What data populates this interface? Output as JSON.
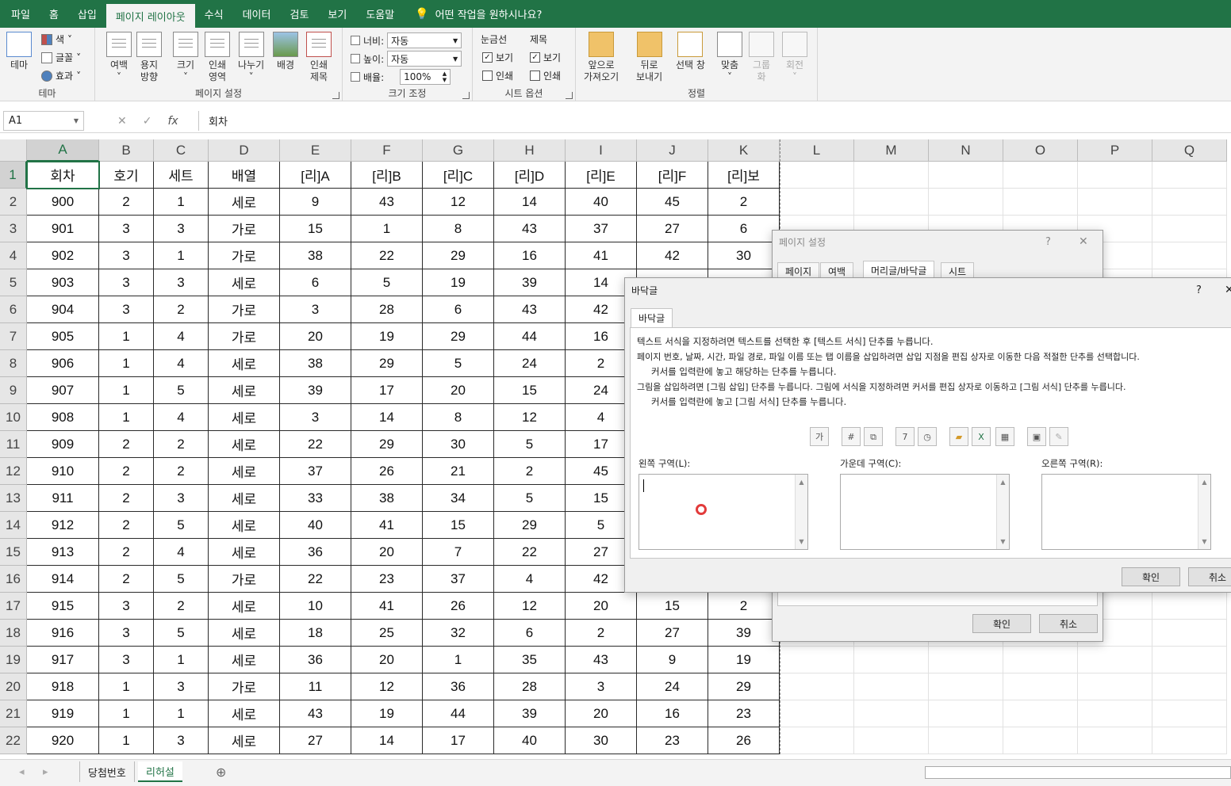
{
  "menu": {
    "tabs": [
      "파일",
      "홈",
      "삽입",
      "페이지 레이아웃",
      "수식",
      "데이터",
      "검토",
      "보기",
      "도움말"
    ],
    "active_tab": "페이지 레이아웃",
    "tell_me": "어떤 작업을 원하시나요?"
  },
  "ribbon": {
    "theme": {
      "label": "테마",
      "btn": "테마",
      "colors": "색",
      "fonts": "글꼴",
      "effects": "효과"
    },
    "page_setup": {
      "label": "페이지 설정",
      "margins": "여백",
      "orientation_1": "용지",
      "orientation_2": "방향",
      "size": "크기",
      "print_area_1": "인쇄",
      "print_area_2": "영역",
      "breaks": "나누기",
      "background": "배경",
      "print_titles_1": "인쇄",
      "print_titles_2": "제목"
    },
    "scale": {
      "label": "크기 조정",
      "width_label": "너비:",
      "width_value": "자동",
      "height_label": "높이:",
      "height_value": "자동",
      "scale_label": "배율:",
      "scale_value": "100%"
    },
    "sheet_options": {
      "label": "시트 옵션",
      "gridlines": "눈금선",
      "headings": "제목",
      "view": "보기",
      "print": "인쇄"
    },
    "arrange": {
      "label": "정렬",
      "bring_forward_1": "앞으로",
      "bring_forward_2": "가져오기",
      "send_backward_1": "뒤로",
      "send_backward_2": "보내기",
      "selection_pane": "선택 창",
      "align": "맞춤",
      "group_1": "그룹",
      "group_2": "화",
      "rotate": "회전"
    }
  },
  "formula_bar": {
    "name_box": "A1",
    "content": "회차",
    "fx": "fx"
  },
  "grid": {
    "columns": [
      "A",
      "B",
      "C",
      "D",
      "E",
      "F",
      "G",
      "H",
      "I",
      "J",
      "K",
      "L",
      "M",
      "N",
      "O",
      "P",
      "Q"
    ],
    "header_row": [
      "회차",
      "호기",
      "세트",
      "배열",
      "[리]A",
      "[리]B",
      "[리]C",
      "[리]D",
      "[리]E",
      "[리]F",
      "[리]보"
    ],
    "rows": [
      [
        "900",
        "2",
        "1",
        "세로",
        "9",
        "43",
        "12",
        "14",
        "40",
        "45",
        "2"
      ],
      [
        "901",
        "3",
        "3",
        "가로",
        "15",
        "1",
        "8",
        "43",
        "37",
        "27",
        "6"
      ],
      [
        "902",
        "3",
        "1",
        "가로",
        "38",
        "22",
        "29",
        "16",
        "41",
        "42",
        "30"
      ],
      [
        "903",
        "3",
        "3",
        "세로",
        "6",
        "5",
        "19",
        "39",
        "14",
        "",
        ""
      ],
      [
        "904",
        "3",
        "2",
        "가로",
        "3",
        "28",
        "6",
        "43",
        "42",
        "",
        ""
      ],
      [
        "905",
        "1",
        "4",
        "가로",
        "20",
        "19",
        "29",
        "44",
        "16",
        "",
        ""
      ],
      [
        "906",
        "1",
        "4",
        "세로",
        "38",
        "29",
        "5",
        "24",
        "2",
        "",
        ""
      ],
      [
        "907",
        "1",
        "5",
        "세로",
        "39",
        "17",
        "20",
        "15",
        "24",
        "",
        ""
      ],
      [
        "908",
        "1",
        "4",
        "세로",
        "3",
        "14",
        "8",
        "12",
        "4",
        "",
        ""
      ],
      [
        "909",
        "2",
        "2",
        "세로",
        "22",
        "29",
        "30",
        "5",
        "17",
        "",
        ""
      ],
      [
        "910",
        "2",
        "2",
        "세로",
        "37",
        "26",
        "21",
        "2",
        "45",
        "",
        ""
      ],
      [
        "911",
        "2",
        "3",
        "세로",
        "33",
        "38",
        "34",
        "5",
        "15",
        "",
        ""
      ],
      [
        "912",
        "2",
        "5",
        "세로",
        "40",
        "41",
        "15",
        "29",
        "5",
        "",
        ""
      ],
      [
        "913",
        "2",
        "4",
        "세로",
        "36",
        "20",
        "7",
        "22",
        "27",
        "",
        ""
      ],
      [
        "914",
        "2",
        "5",
        "가로",
        "22",
        "23",
        "37",
        "4",
        "42",
        "",
        ""
      ],
      [
        "915",
        "3",
        "2",
        "세로",
        "10",
        "41",
        "26",
        "12",
        "20",
        "15",
        "2"
      ],
      [
        "916",
        "3",
        "5",
        "세로",
        "18",
        "25",
        "32",
        "6",
        "2",
        "27",
        "39"
      ],
      [
        "917",
        "3",
        "1",
        "세로",
        "36",
        "20",
        "1",
        "35",
        "43",
        "9",
        "19"
      ],
      [
        "918",
        "1",
        "3",
        "가로",
        "11",
        "12",
        "36",
        "28",
        "3",
        "24",
        "29"
      ],
      [
        "919",
        "1",
        "1",
        "세로",
        "43",
        "19",
        "44",
        "39",
        "20",
        "16",
        "23"
      ],
      [
        "920",
        "1",
        "3",
        "세로",
        "27",
        "14",
        "17",
        "40",
        "30",
        "23",
        "26"
      ]
    ]
  },
  "sheets": {
    "tabs": [
      "당첨번호",
      "리허설"
    ],
    "active": "리허설"
  },
  "page_setup_dialog": {
    "title": "페이지 설정",
    "help": "?",
    "close": "✕",
    "tabs": [
      "페이지",
      "여백",
      "머리글/바닥글",
      "시트"
    ],
    "active_tab": "머리글/바닥글",
    "ok": "확인",
    "cancel": "취소"
  },
  "footer_dialog": {
    "title": "바닥글",
    "help": "?",
    "close": "✕",
    "tab": "바닥글",
    "instructions": [
      "텍스트 서식을 지정하려면 텍스트를 선택한 후 [텍스트 서식] 단추를 누릅니다.",
      "페이지 번호, 날짜, 시간, 파일 경로, 파일 이름 또는 탭 이름을 삽입하려면 삽입 지점을 편집 상자로 이동한 다음 적절한 단추를 선택합니다.",
      "커서를 입력란에 놓고 해당하는 단추를 누릅니다.",
      "그림을 삽입하려면 [그림 삽입] 단추를 누릅니다.  그림에 서식을 지정하려면 커서를 편집 상자로 이동하고 [그림 서식] 단추를 누릅니다.",
      "커서를 입력란에 놓고 [그림 서식] 단추를 누릅니다."
    ],
    "format_text_icon": "가",
    "left_label": "왼쪽 구역(L):",
    "center_label": "가운데 구역(C):",
    "right_label": "오른쪽 구역(R):",
    "ok": "확인",
    "cancel": "취소"
  },
  "colors": {
    "excel_green": "#217346",
    "ribbon_bg": "#f3f3f3"
  }
}
